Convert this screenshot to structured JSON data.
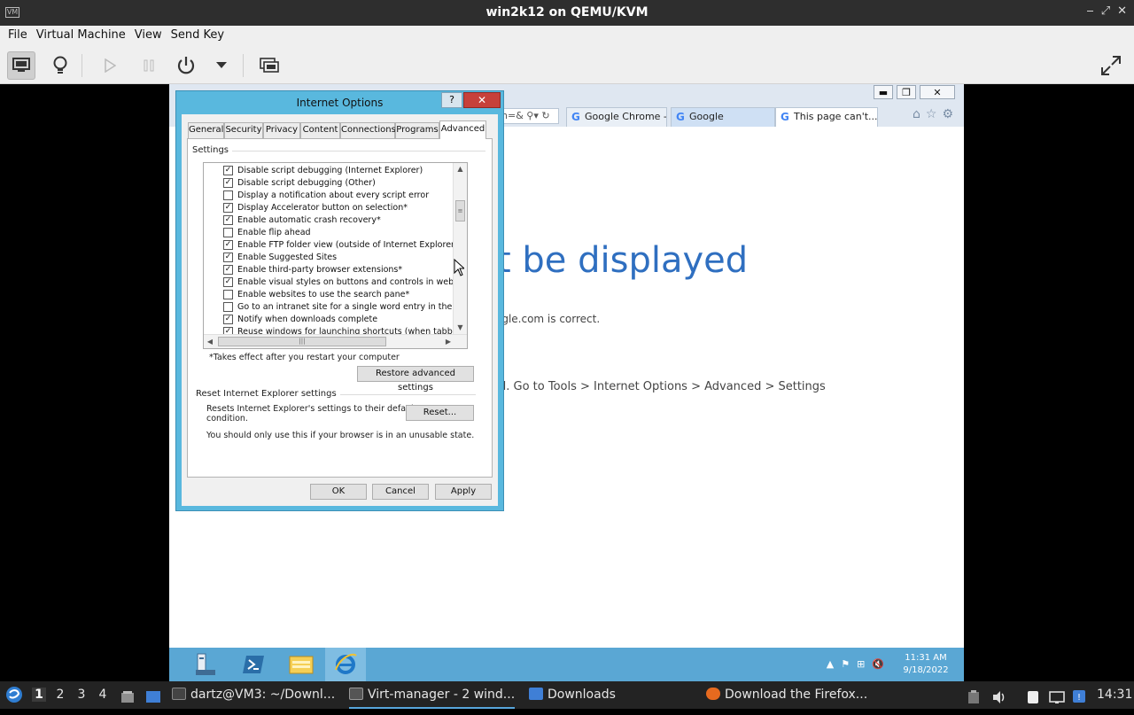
{
  "host_window": {
    "title": "win2k12 on QEMU/KVM",
    "app_icon": "VM",
    "controls": [
      "‒",
      "⤢",
      "✕"
    ]
  },
  "host_menu": [
    "File",
    "Virtual Machine",
    "View",
    "Send Key"
  ],
  "ie": {
    "address_fragment": "n=&",
    "tabs": [
      {
        "label": "Google Chrome - ..."
      },
      {
        "label": "Google"
      },
      {
        "label": "This page can't..."
      }
    ],
    "heading": "t be displayed",
    "line1": "ogle.com is correct.",
    "line2": "d. Go to Tools > Internet Options > Advanced > Settings"
  },
  "win_clock": {
    "time": "11:31 AM",
    "date": "9/18/2022"
  },
  "dialog": {
    "title": "Internet Options",
    "help": "?",
    "close": "✕",
    "tabs": [
      "General",
      "Security",
      "Privacy",
      "Content",
      "Connections",
      "Programs",
      "Advanced"
    ],
    "active_tab": "Advanced",
    "settings_label": "Settings",
    "settings": [
      {
        "label": "Disable script debugging (Internet Explorer)",
        "checked": true
      },
      {
        "label": "Disable script debugging (Other)",
        "checked": true
      },
      {
        "label": "Display a notification about every script error",
        "checked": false
      },
      {
        "label": "Display Accelerator button on selection*",
        "checked": true
      },
      {
        "label": "Enable automatic crash recovery*",
        "checked": true
      },
      {
        "label": "Enable flip ahead",
        "checked": false
      },
      {
        "label": "Enable FTP folder view (outside of Internet Explorer)",
        "checked": true
      },
      {
        "label": "Enable Suggested Sites",
        "checked": true
      },
      {
        "label": "Enable third-party browser extensions*",
        "checked": true
      },
      {
        "label": "Enable visual styles on buttons and controls in webpages",
        "checked": true
      },
      {
        "label": "Enable websites to use the search pane*",
        "checked": false
      },
      {
        "label": "Go to an intranet site for a single word entry in the Address bar",
        "checked": false
      },
      {
        "label": "Notify when downloads complete",
        "checked": true
      },
      {
        "label": "Reuse windows for launching shortcuts (when tabbed browsing is off)",
        "checked": true
      }
    ],
    "restart_note": "*Takes effect after you restart your computer",
    "restore_button": "Restore advanced settings",
    "reset_group_label": "Reset Internet Explorer settings",
    "reset_desc": "Resets Internet Explorer's settings to their default",
    "reset_desc2": "condition.",
    "reset_button": "Reset...",
    "reset_warning": "You should only use this if your browser is in an unusable state.",
    "ok": "OK",
    "cancel": "Cancel",
    "apply": "Apply"
  },
  "host_panel": {
    "workspaces": [
      "1",
      "2",
      "3",
      "4"
    ],
    "current_workspace": "1",
    "tasks": [
      {
        "label": "dartz@VM3: ~/Downl...",
        "icon": "terminal-icon"
      },
      {
        "label": "Virt-manager - 2 wind...",
        "icon": "virt-manager-icon"
      },
      {
        "label": "Downloads",
        "icon": "folder-icon"
      },
      {
        "label": "Download the Firefox...",
        "icon": "firefox-icon"
      }
    ],
    "clock": "14:31"
  }
}
